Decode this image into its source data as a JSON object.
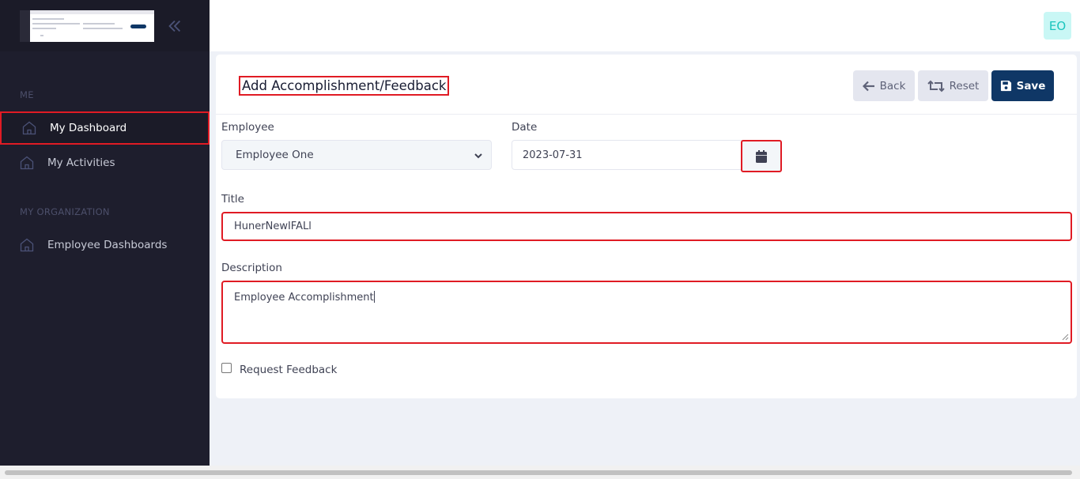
{
  "sidebar": {
    "sections": [
      {
        "label": "ME"
      },
      {
        "label": "MY ORGANIZATION"
      }
    ],
    "items": [
      {
        "label": "My Dashboard",
        "icon": "home-icon",
        "active": true
      },
      {
        "label": "My Activities",
        "icon": "home-icon",
        "active": false
      },
      {
        "label": "Employee Dashboards",
        "icon": "home-icon",
        "active": false
      }
    ]
  },
  "header": {
    "avatar_initials": "EO"
  },
  "form": {
    "title": "Add Accomplishment/Feedback",
    "buttons": {
      "back": "Back",
      "reset": "Reset",
      "save": "Save"
    },
    "employee": {
      "label": "Employee",
      "value": "Employee One"
    },
    "date": {
      "label": "Date",
      "value": "2023-07-31"
    },
    "title_field": {
      "label": "Title",
      "value": "HunerNewIFALl"
    },
    "description": {
      "label": "Description",
      "value": "Employee Accomplishment"
    },
    "request_feedback": {
      "label": "Request Feedback",
      "checked": false
    }
  },
  "colors": {
    "sidebar_bg": "#1e1e2d",
    "primary": "#0f3766",
    "highlight": "#e01b24",
    "avatar_bg": "#c9f7f5",
    "avatar_text": "#1bc5bd"
  }
}
